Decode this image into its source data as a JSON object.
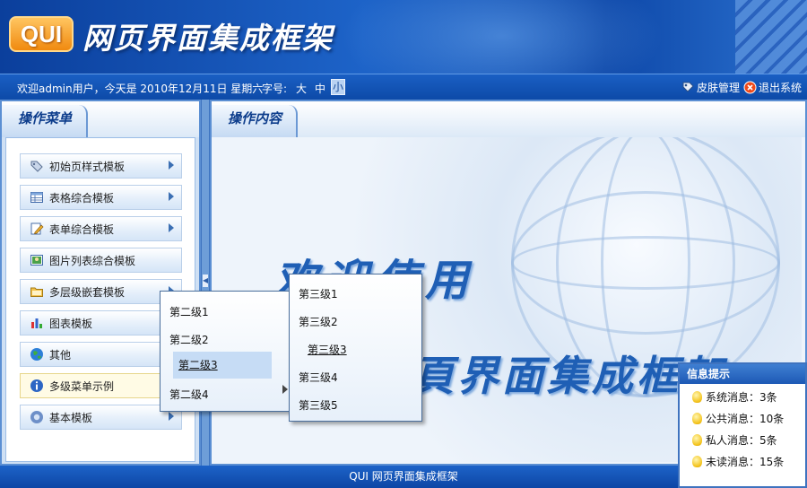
{
  "header": {
    "logo_text": "QUI",
    "title": "网页界面集成框架"
  },
  "infobar": {
    "welcome": "欢迎admin用户，今天是 2010年12月11日 星期六",
    "font_label": "字号:",
    "font_large": "大",
    "font_medium": "中",
    "font_small": "小",
    "skin_label": "皮肤管理",
    "logout_label": "退出系统"
  },
  "left_panel": {
    "tab_title": "操作菜单",
    "items": [
      {
        "label": "初始页样式模板",
        "icon": "tag-icon",
        "has_arrow": true
      },
      {
        "label": "表格综合模板",
        "icon": "table-icon",
        "has_arrow": true
      },
      {
        "label": "表单综合模板",
        "icon": "form-edit-icon",
        "has_arrow": true
      },
      {
        "label": "图片列表综合模板",
        "icon": "picture-icon",
        "has_arrow": false
      },
      {
        "label": "多层级嵌套模板",
        "icon": "folder-icon",
        "has_arrow": true
      },
      {
        "label": "图表模板",
        "icon": "bar-chart-icon",
        "has_arrow": false
      },
      {
        "label": "其他",
        "icon": "globe-icon",
        "has_arrow": false
      },
      {
        "label": "多级菜单示例",
        "icon": "info-icon",
        "has_arrow": false
      },
      {
        "label": "基本模板",
        "icon": "help-icon",
        "has_arrow": true
      }
    ]
  },
  "right_panel": {
    "tab_title": "操作内容",
    "welcome_line1": "欢迎使用",
    "welcome_line2": "网頁界面集成框架"
  },
  "submenu_level2": [
    "第二级1",
    "第二级2",
    "第二级3",
    "第二级4"
  ],
  "submenu_level3": [
    "第三级1",
    "第三级2",
    "第三级3",
    "第三级4",
    "第三级5"
  ],
  "footer": {
    "text": "QUI 网页界面集成框架"
  },
  "info_tip": {
    "title": "信息提示",
    "rows": [
      "系统消息：3条",
      "公共消息：10条",
      "私人消息：5条",
      "未读消息：15条"
    ]
  }
}
